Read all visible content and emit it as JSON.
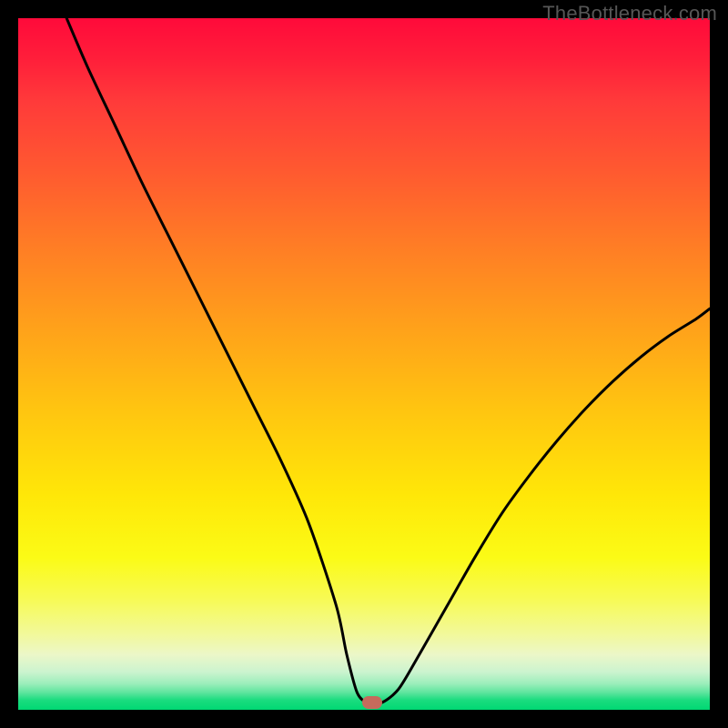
{
  "watermark": "TheBottleneck.com",
  "chart_data": {
    "type": "line",
    "title": "",
    "xlabel": "",
    "ylabel": "",
    "xlim": [
      0,
      100
    ],
    "ylim": [
      0,
      100
    ],
    "grid": false,
    "legend": false,
    "gradient_stops": [
      {
        "pos": 0,
        "color": "#ff0a3a"
      },
      {
        "pos": 22,
        "color": "#ff5930"
      },
      {
        "pos": 45,
        "color": "#ffa21a"
      },
      {
        "pos": 69,
        "color": "#ffe708"
      },
      {
        "pos": 84,
        "color": "#f7fa55"
      },
      {
        "pos": 94.5,
        "color": "#ccf4cf"
      },
      {
        "pos": 98.6,
        "color": "#1adc7f"
      },
      {
        "pos": 100,
        "color": "#00d873"
      }
    ],
    "series": [
      {
        "name": "bottleneck-curve",
        "x": [
          7,
          10,
          14,
          18,
          22,
          26,
          30,
          34,
          38,
          42,
          46,
          47.5,
          49,
          50.5,
          52.5,
          55,
          58,
          62,
          66,
          70,
          74,
          78,
          82,
          86,
          90,
          94,
          98,
          100
        ],
        "y": [
          100,
          93,
          84.5,
          76,
          68,
          60,
          52,
          44,
          36,
          27,
          15,
          8,
          2.5,
          1,
          1,
          3,
          8,
          15,
          22,
          28.5,
          34,
          39,
          43.5,
          47.5,
          51,
          54,
          56.5,
          58
        ]
      }
    ],
    "marker": {
      "x": 51.2,
      "y": 1.1,
      "color": "#c66a5c"
    }
  }
}
